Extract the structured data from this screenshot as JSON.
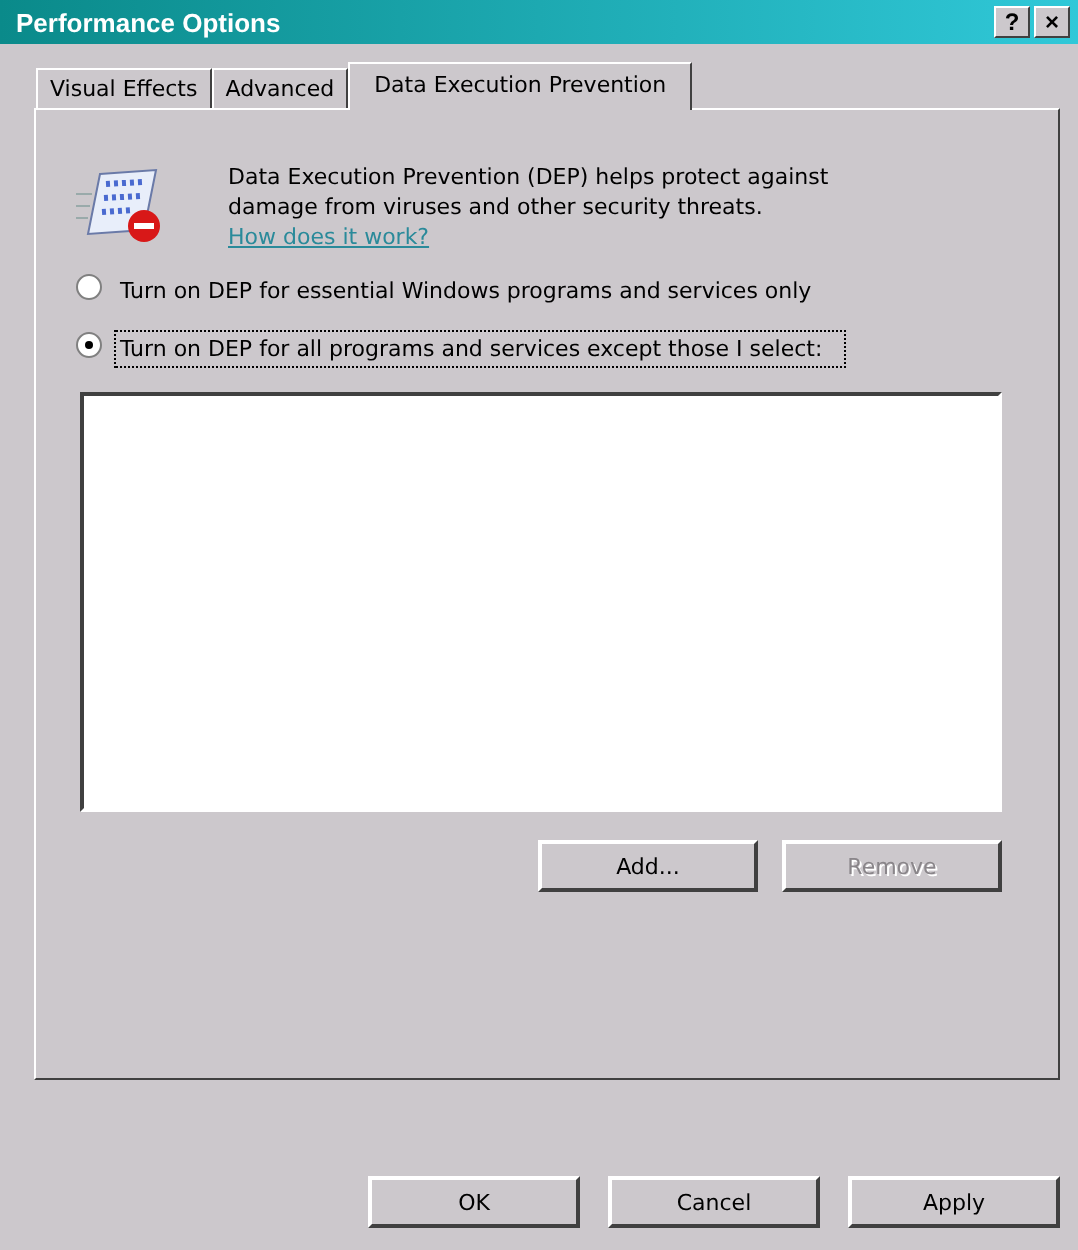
{
  "window": {
    "title": "Performance Options",
    "help_button": "?",
    "close_button": "×"
  },
  "tabs": [
    {
      "label": "Visual Effects",
      "selected": false
    },
    {
      "label": "Advanced",
      "selected": false
    },
    {
      "label": "Data Execution Prevention",
      "selected": true
    }
  ],
  "description": {
    "text": "Data Execution Prevention (DEP) helps protect against damage from viruses and other security threats.",
    "link": "How does it work?"
  },
  "options": [
    {
      "label": "Turn on DEP for essential Windows programs and services only",
      "selected": false
    },
    {
      "label": "Turn on DEP for all programs and services except those I select:",
      "selected": true
    }
  ],
  "list_buttons": [
    {
      "label": "Add...",
      "disabled": false
    },
    {
      "label": "Remove",
      "disabled": true
    }
  ],
  "buttons": [
    {
      "label": "OK",
      "disabled": false
    },
    {
      "label": "Cancel",
      "disabled": false
    },
    {
      "label": "Apply",
      "disabled": false
    }
  ]
}
